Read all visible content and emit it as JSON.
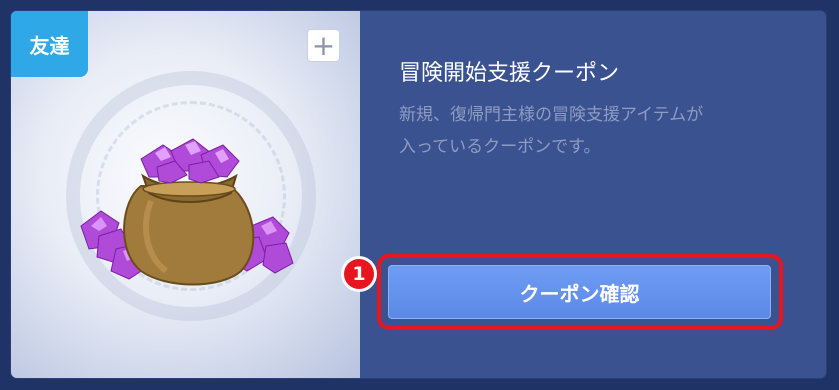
{
  "coupon": {
    "tag": "友達",
    "title": "冒険開始支援クーポン",
    "description_line1": "新規、復帰門主様の冒険支援アイテムが",
    "description_line2": "入っているクーポンです。",
    "confirm_label": "クーポン確認",
    "add_glyph": "+"
  },
  "annotation": {
    "step": "1"
  },
  "colors": {
    "tag": "#2ea8e6",
    "panel": "#3b5290",
    "button": "#6f9cf3",
    "highlight": "#e8141e"
  },
  "icons": {
    "reward": "gem-pouch-icon",
    "add": "plus-icon"
  }
}
